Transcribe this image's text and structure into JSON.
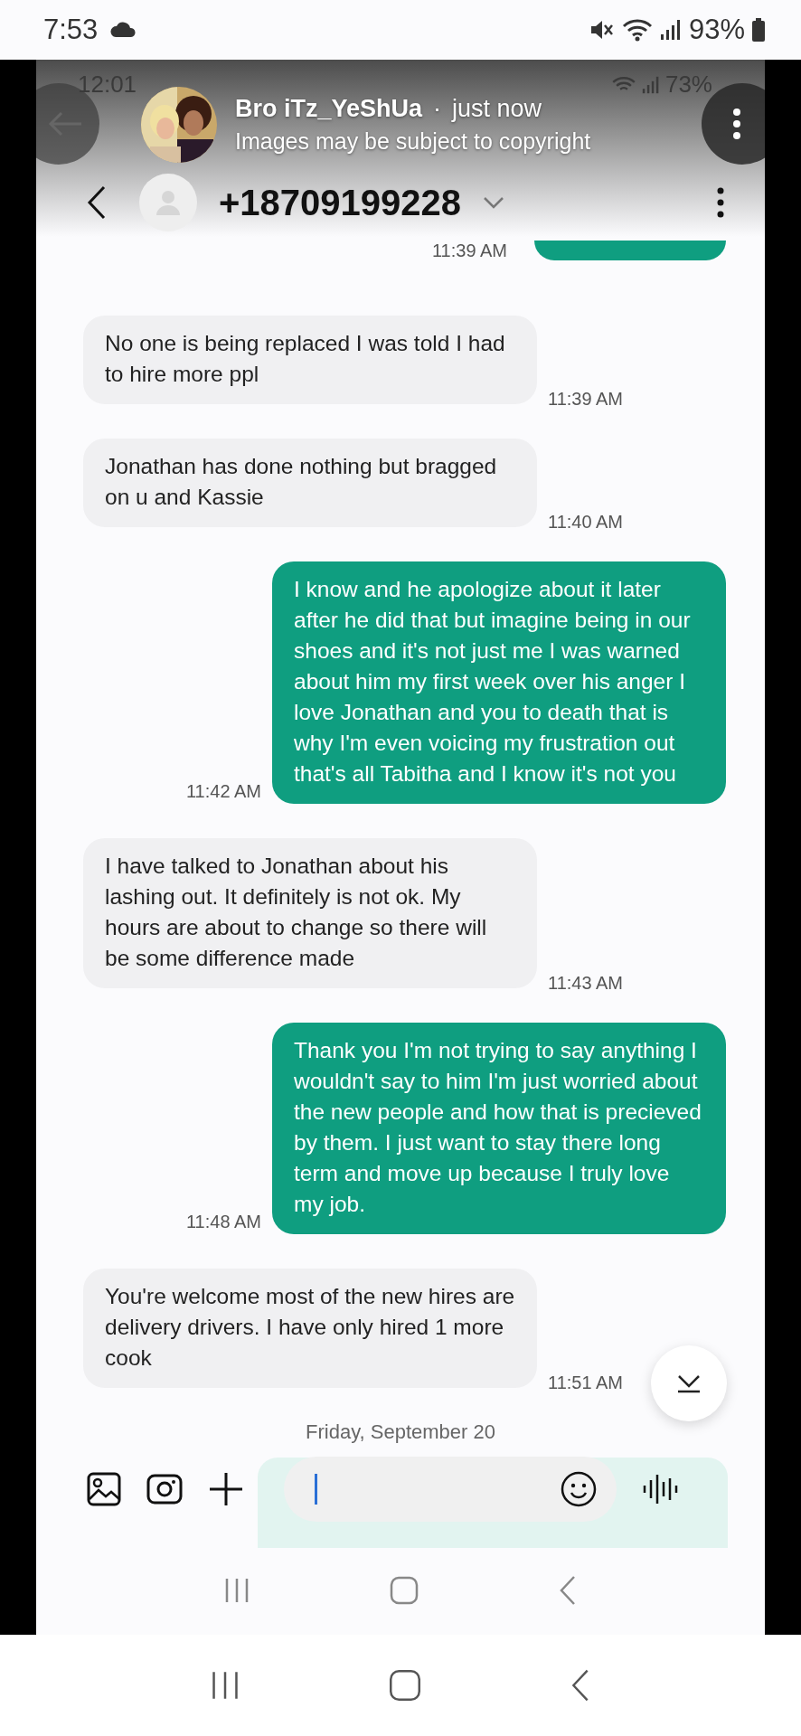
{
  "status_bar": {
    "time": "7:53",
    "battery": "93%"
  },
  "screenshot_status": {
    "time": "12:01",
    "battery": "73%"
  },
  "notification": {
    "sender": "Bro iTz_YeShUa",
    "separator": "·",
    "time": "just now",
    "subtitle": "Images may be subject to copyright"
  },
  "conversation": {
    "contact": "+18709199228"
  },
  "messages": [
    {
      "kind": "partial_sent",
      "time": "11:39 AM"
    },
    {
      "kind": "received",
      "text": "No one is being replaced I was told I had to hire more ppl",
      "time": "11:39 AM"
    },
    {
      "kind": "received",
      "text": "Jonathan has done nothing but bragged on u and Kassie",
      "time": "11:40 AM"
    },
    {
      "kind": "sent",
      "text": "I know and he apologize about it later after he did that but imagine being in our shoes and it's not just me I was warned about him my first week over his anger I love Jonathan and you to death that is why I'm even voicing my frustration out that's all Tabitha and I know it's not you",
      "time": "11:42 AM"
    },
    {
      "kind": "received",
      "text": "I have talked to Jonathan about his lashing out. It definitely is not ok. My hours are about to change so there will be some difference made",
      "time": "11:43 AM"
    },
    {
      "kind": "sent",
      "text": "Thank you I'm not trying to say anything I wouldn't say to him I'm just worried about the new people and how that is precieved by them. I just want to stay there long term and move up because I truly love my job.",
      "time": "11:48 AM"
    },
    {
      "kind": "received",
      "text": "You're welcome most of the new hires are delivery drivers. I have only hired 1 more cook",
      "time": "11:51 AM"
    }
  ],
  "date_divider": "Friday, September 20",
  "composer": {
    "focused": true
  }
}
